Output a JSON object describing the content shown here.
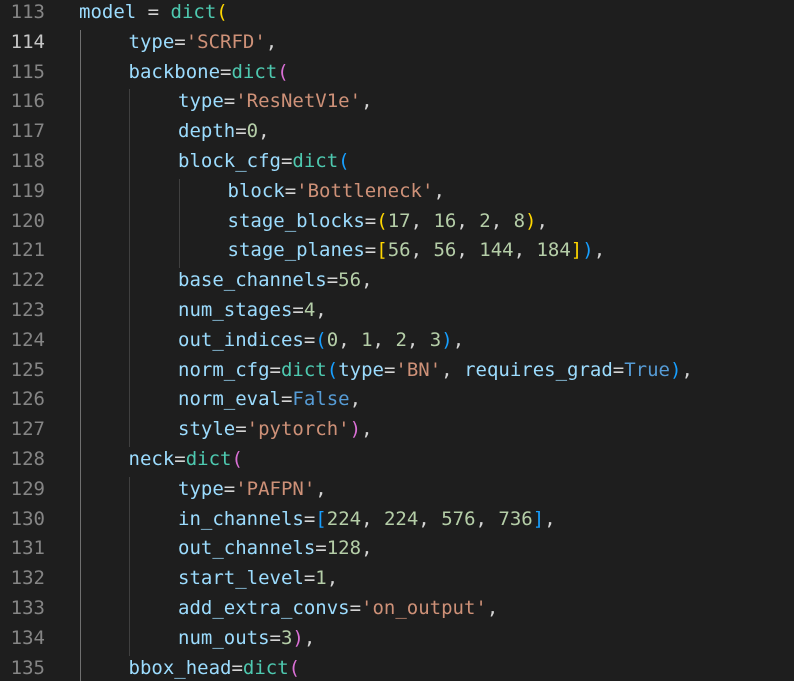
{
  "editor": {
    "language": "python",
    "active_line": 114,
    "colors": {
      "background": "#1e1e1e",
      "line_number": "#858585",
      "line_number_active": "#c6c6c6",
      "variable": "#9cdcfe",
      "function": "#4ec9b0",
      "string": "#ce9178",
      "number": "#b5cea8",
      "keyword": "#569cd6",
      "operator": "#d4d4d4",
      "bracket_level_1": "#ffd700",
      "bracket_level_2": "#da70d6",
      "bracket_level_3": "#179fff"
    },
    "lines": [
      {
        "n": "113",
        "indent": 0,
        "tokens": [
          [
            "var",
            "model"
          ],
          [
            "op",
            " = "
          ],
          [
            "fn",
            "dict"
          ],
          [
            "b1",
            "("
          ]
        ]
      },
      {
        "n": "114",
        "indent": 1,
        "tokens": [
          [
            "var",
            "type"
          ],
          [
            "op",
            "="
          ],
          [
            "str",
            "'SCRFD'"
          ],
          [
            "op",
            ","
          ]
        ]
      },
      {
        "n": "115",
        "indent": 1,
        "tokens": [
          [
            "var",
            "backbone"
          ],
          [
            "op",
            "="
          ],
          [
            "fn",
            "dict"
          ],
          [
            "b2",
            "("
          ]
        ]
      },
      {
        "n": "116",
        "indent": 2,
        "tokens": [
          [
            "var",
            "type"
          ],
          [
            "op",
            "="
          ],
          [
            "str",
            "'ResNetV1e'"
          ],
          [
            "op",
            ","
          ]
        ]
      },
      {
        "n": "117",
        "indent": 2,
        "tokens": [
          [
            "var",
            "depth"
          ],
          [
            "op",
            "="
          ],
          [
            "num",
            "0"
          ],
          [
            "op",
            ","
          ]
        ]
      },
      {
        "n": "118",
        "indent": 2,
        "tokens": [
          [
            "var",
            "block_cfg"
          ],
          [
            "op",
            "="
          ],
          [
            "fn",
            "dict"
          ],
          [
            "b3",
            "("
          ]
        ]
      },
      {
        "n": "119",
        "indent": 3,
        "tokens": [
          [
            "var",
            "block"
          ],
          [
            "op",
            "="
          ],
          [
            "str",
            "'Bottleneck'"
          ],
          [
            "op",
            ","
          ]
        ]
      },
      {
        "n": "120",
        "indent": 3,
        "tokens": [
          [
            "var",
            "stage_blocks"
          ],
          [
            "op",
            "="
          ],
          [
            "b1",
            "("
          ],
          [
            "num",
            "17"
          ],
          [
            "op",
            ", "
          ],
          [
            "num",
            "16"
          ],
          [
            "op",
            ", "
          ],
          [
            "num",
            "2"
          ],
          [
            "op",
            ", "
          ],
          [
            "num",
            "8"
          ],
          [
            "b1",
            ")"
          ],
          [
            "op",
            ","
          ]
        ]
      },
      {
        "n": "121",
        "indent": 3,
        "tokens": [
          [
            "var",
            "stage_planes"
          ],
          [
            "op",
            "="
          ],
          [
            "b1",
            "["
          ],
          [
            "num",
            "56"
          ],
          [
            "op",
            ", "
          ],
          [
            "num",
            "56"
          ],
          [
            "op",
            ", "
          ],
          [
            "num",
            "144"
          ],
          [
            "op",
            ", "
          ],
          [
            "num",
            "184"
          ],
          [
            "b1",
            "]"
          ],
          [
            "b3",
            ")"
          ],
          [
            "op",
            ","
          ]
        ]
      },
      {
        "n": "122",
        "indent": 2,
        "tokens": [
          [
            "var",
            "base_channels"
          ],
          [
            "op",
            "="
          ],
          [
            "num",
            "56"
          ],
          [
            "op",
            ","
          ]
        ]
      },
      {
        "n": "123",
        "indent": 2,
        "tokens": [
          [
            "var",
            "num_stages"
          ],
          [
            "op",
            "="
          ],
          [
            "num",
            "4"
          ],
          [
            "op",
            ","
          ]
        ]
      },
      {
        "n": "124",
        "indent": 2,
        "tokens": [
          [
            "var",
            "out_indices"
          ],
          [
            "op",
            "="
          ],
          [
            "b3",
            "("
          ],
          [
            "num",
            "0"
          ],
          [
            "op",
            ", "
          ],
          [
            "num",
            "1"
          ],
          [
            "op",
            ", "
          ],
          [
            "num",
            "2"
          ],
          [
            "op",
            ", "
          ],
          [
            "num",
            "3"
          ],
          [
            "b3",
            ")"
          ],
          [
            "op",
            ","
          ]
        ]
      },
      {
        "n": "125",
        "indent": 2,
        "tokens": [
          [
            "var",
            "norm_cfg"
          ],
          [
            "op",
            "="
          ],
          [
            "fn",
            "dict"
          ],
          [
            "b3",
            "("
          ],
          [
            "var",
            "type"
          ],
          [
            "op",
            "="
          ],
          [
            "str",
            "'BN'"
          ],
          [
            "op",
            ", "
          ],
          [
            "var",
            "requires_grad"
          ],
          [
            "op",
            "="
          ],
          [
            "kw",
            "True"
          ],
          [
            "b3",
            ")"
          ],
          [
            "op",
            ","
          ]
        ]
      },
      {
        "n": "126",
        "indent": 2,
        "tokens": [
          [
            "var",
            "norm_eval"
          ],
          [
            "op",
            "="
          ],
          [
            "kw",
            "False"
          ],
          [
            "op",
            ","
          ]
        ]
      },
      {
        "n": "127",
        "indent": 2,
        "tokens": [
          [
            "var",
            "style"
          ],
          [
            "op",
            "="
          ],
          [
            "str",
            "'pytorch'"
          ],
          [
            "b2",
            ")"
          ],
          [
            "op",
            ","
          ]
        ]
      },
      {
        "n": "128",
        "indent": 1,
        "tokens": [
          [
            "var",
            "neck"
          ],
          [
            "op",
            "="
          ],
          [
            "fn",
            "dict"
          ],
          [
            "b2",
            "("
          ]
        ]
      },
      {
        "n": "129",
        "indent": 2,
        "tokens": [
          [
            "var",
            "type"
          ],
          [
            "op",
            "="
          ],
          [
            "str",
            "'PAFPN'"
          ],
          [
            "op",
            ","
          ]
        ]
      },
      {
        "n": "130",
        "indent": 2,
        "tokens": [
          [
            "var",
            "in_channels"
          ],
          [
            "op",
            "="
          ],
          [
            "b3",
            "["
          ],
          [
            "num",
            "224"
          ],
          [
            "op",
            ", "
          ],
          [
            "num",
            "224"
          ],
          [
            "op",
            ", "
          ],
          [
            "num",
            "576"
          ],
          [
            "op",
            ", "
          ],
          [
            "num",
            "736"
          ],
          [
            "b3",
            "]"
          ],
          [
            "op",
            ","
          ]
        ]
      },
      {
        "n": "131",
        "indent": 2,
        "tokens": [
          [
            "var",
            "out_channels"
          ],
          [
            "op",
            "="
          ],
          [
            "num",
            "128"
          ],
          [
            "op",
            ","
          ]
        ]
      },
      {
        "n": "132",
        "indent": 2,
        "tokens": [
          [
            "var",
            "start_level"
          ],
          [
            "op",
            "="
          ],
          [
            "num",
            "1"
          ],
          [
            "op",
            ","
          ]
        ]
      },
      {
        "n": "133",
        "indent": 2,
        "tokens": [
          [
            "var",
            "add_extra_convs"
          ],
          [
            "op",
            "="
          ],
          [
            "str",
            "'on_output'"
          ],
          [
            "op",
            ","
          ]
        ]
      },
      {
        "n": "134",
        "indent": 2,
        "tokens": [
          [
            "var",
            "num_outs"
          ],
          [
            "op",
            "="
          ],
          [
            "num",
            "3"
          ],
          [
            "b2",
            ")"
          ],
          [
            "op",
            ","
          ]
        ]
      },
      {
        "n": "135",
        "indent": 1,
        "tokens": [
          [
            "var",
            "bbox_head"
          ],
          [
            "op",
            "="
          ],
          [
            "fn",
            "dict"
          ],
          [
            "b2",
            "("
          ]
        ]
      }
    ]
  }
}
